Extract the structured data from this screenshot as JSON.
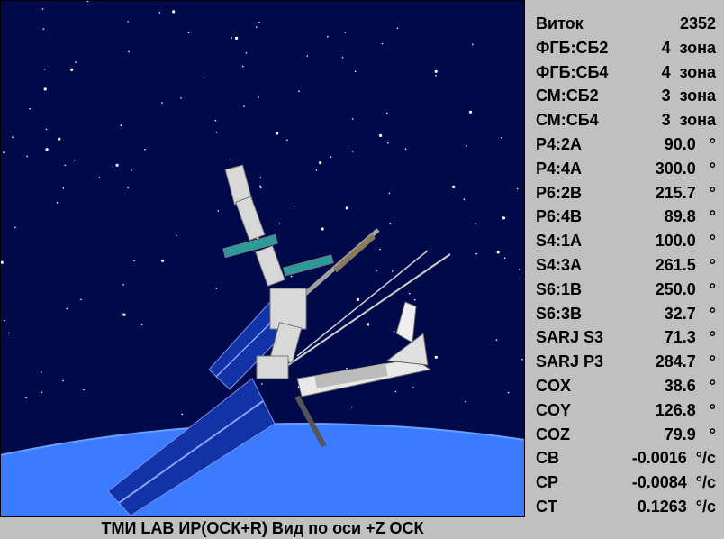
{
  "scene": {
    "caption": "ТМИ LAB ИР(ОСК+R) Вид по оси +Z ОСК",
    "colors": {
      "space": "#000a4a",
      "earth": "#3a7bff",
      "panel_blue": "#1233a8",
      "truss": "#c8c8c8"
    }
  },
  "telemetry": [
    {
      "label": "Виток",
      "value": "2352"
    },
    {
      "label": "ФГБ:СБ2",
      "value": "4  зона"
    },
    {
      "label": "ФГБ:СБ4",
      "value": "4  зона"
    },
    {
      "label": "СМ:СБ2",
      "value": "3  зона"
    },
    {
      "label": "СМ:СБ4",
      "value": "3  зона"
    },
    {
      "label": "P4:2A",
      "value": "90.0   °"
    },
    {
      "label": "P4:4A",
      "value": "300.0   °"
    },
    {
      "label": "P6:2B",
      "value": "215.7   °"
    },
    {
      "label": "P6:4B",
      "value": "89.8   °"
    },
    {
      "label": "S4:1A",
      "value": "100.0   °"
    },
    {
      "label": "S4:3A",
      "value": "261.5   °"
    },
    {
      "label": "S6:1B",
      "value": "250.0   °"
    },
    {
      "label": "S6:3B",
      "value": "32.7   °"
    },
    {
      "label": "SARJ S3",
      "value": "71.3   °"
    },
    {
      "label": "SARJ P3",
      "value": "284.7   °"
    },
    {
      "label": "COX",
      "value": "38.6   °"
    },
    {
      "label": "COY",
      "value": "126.8   °"
    },
    {
      "label": "COZ",
      "value": "79.9   °"
    },
    {
      "label": "CB",
      "value": "-0.0016  °/c"
    },
    {
      "label": "CP",
      "value": "-0.0084  °/c"
    },
    {
      "label": "CT",
      "value": "0.1263  °/c"
    }
  ]
}
